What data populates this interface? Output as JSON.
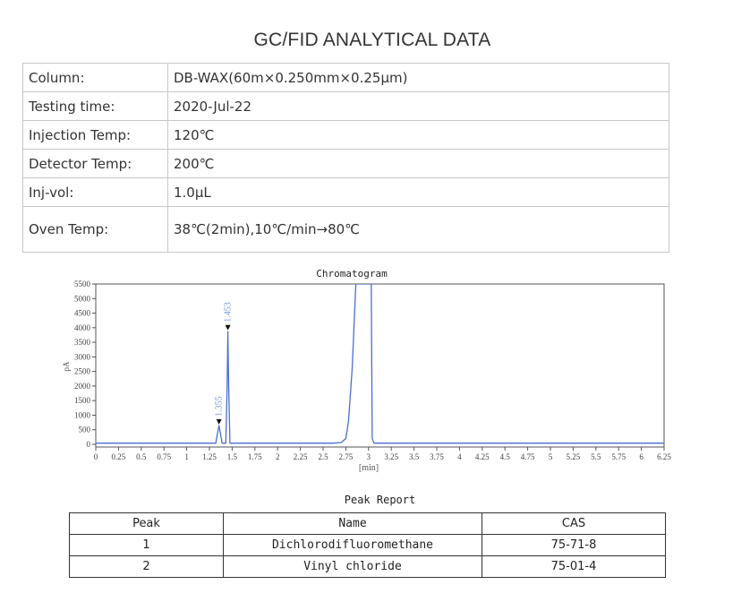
{
  "title": "GC/FID ANALYTICAL DATA",
  "params": [
    {
      "label": "Column:",
      "value": "DB-WAX(60m×0.250mm×0.25μm)"
    },
    {
      "label": "Testing time:",
      "value": "2020-Jul-22"
    },
    {
      "label": "Injection Temp:",
      "value": "120℃"
    },
    {
      "label": "Detector Temp:",
      "value": "200℃"
    },
    {
      "label": "Inj-vol:",
      "value": "1.0μL"
    },
    {
      "label": "Oven Temp:",
      "value": "38℃(2min),10℃/min→80℃"
    }
  ],
  "chart_data": {
    "type": "line",
    "title": "Chromatogram",
    "xlabel": "[min]",
    "ylabel": "pA",
    "xlim": [
      0,
      6.25
    ],
    "ylim": [
      0,
      5500
    ],
    "x_ticks": [
      "0",
      "0.25",
      "0.5",
      "0.75",
      "1",
      "1.25",
      "1.5",
      "1.75",
      "2",
      "2.25",
      "2.5",
      "2.75",
      "3",
      "3.25",
      "3.5",
      "3.75",
      "4",
      "4.25",
      "4.5",
      "4.75",
      "5",
      "5.25",
      "5.5",
      "5.75",
      "6",
      "6.25"
    ],
    "y_ticks": [
      "0",
      "500",
      "1000",
      "1500",
      "2000",
      "2500",
      "3000",
      "3500",
      "4000",
      "4500",
      "5000",
      "5500"
    ],
    "grid": false,
    "color": "#4a6fd0",
    "series": [
      {
        "x": [
          0,
          1.32,
          1.335,
          1.355,
          1.375,
          1.39,
          1.43,
          1.445,
          1.453,
          1.462,
          1.475,
          2.6,
          2.7,
          2.75,
          2.78,
          2.82,
          2.85,
          2.86,
          3.03,
          3.04,
          3.06,
          6.25
        ],
        "y": [
          40,
          40,
          300,
          650,
          300,
          40,
          40,
          2000,
          3880,
          2000,
          40,
          40,
          60,
          200,
          800,
          2600,
          4800,
          5500,
          5500,
          200,
          40,
          40
        ]
      }
    ],
    "peak_labels": [
      {
        "x": 1.355,
        "y": 650,
        "label": "1.355"
      },
      {
        "x": 1.453,
        "y": 3880,
        "label": "1.453"
      }
    ]
  },
  "peak_report": {
    "title": "Peak Report",
    "headers": [
      "Peak",
      "Name",
      "CAS"
    ],
    "rows": [
      [
        "1",
        "Dichlorodifluoromethane",
        "75-71-8"
      ],
      [
        "2",
        "Vinyl chloride",
        "75-01-4"
      ]
    ]
  }
}
